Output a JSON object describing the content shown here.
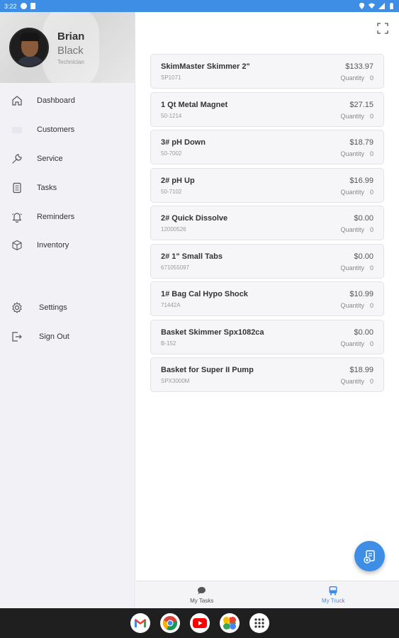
{
  "status_bar": {
    "time": "3:22"
  },
  "profile": {
    "first_name": "Brian",
    "last_name": "Black",
    "role": "Technician"
  },
  "nav": {
    "items": [
      {
        "label": "Dashboard",
        "icon": "home-icon"
      },
      {
        "label": "Customers",
        "icon": "customers-icon"
      },
      {
        "label": "Service",
        "icon": "wrench-icon"
      },
      {
        "label": "Tasks",
        "icon": "tasks-icon"
      },
      {
        "label": "Reminders",
        "icon": "bell-icon"
      },
      {
        "label": "Inventory",
        "icon": "box-icon"
      }
    ],
    "bottom_items": [
      {
        "label": "Settings",
        "icon": "gear-icon"
      },
      {
        "label": "Sign Out",
        "icon": "sign-out-icon"
      }
    ]
  },
  "inventory": {
    "quantity_label": "Quantity",
    "items": [
      {
        "name": "SkimMaster Skimmer 2\"",
        "sku": "SP1071",
        "price": "$133.97",
        "quantity": "0"
      },
      {
        "name": "1 Qt Metal Magnet",
        "sku": "50-1214",
        "price": "$27.15",
        "quantity": "0"
      },
      {
        "name": "3# pH Down",
        "sku": "50-7002",
        "price": "$18.79",
        "quantity": "0"
      },
      {
        "name": "2# pH Up",
        "sku": "50-7102",
        "price": "$16.99",
        "quantity": "0"
      },
      {
        "name": "2# Quick Dissolve",
        "sku": "12000526",
        "price": "$0.00",
        "quantity": "0"
      },
      {
        "name": "2# 1\" Small Tabs",
        "sku": "671055097",
        "price": "$0.00",
        "quantity": "0"
      },
      {
        "name": "1# Bag Cal Hypo Shock",
        "sku": "71442A",
        "price": "$10.99",
        "quantity": "0"
      },
      {
        "name": "Basket Skimmer Spx1082ca",
        "sku": "B-152",
        "price": "$0.00",
        "quantity": "0"
      },
      {
        "name": "Basket for Super II Pump",
        "sku": "SPX3000M",
        "price": "$18.99",
        "quantity": "0"
      }
    ]
  },
  "tabs": {
    "my_tasks": "My Tasks",
    "my_truck": "My Truck"
  },
  "colors": {
    "accent": "#3f8ee6",
    "sidebar_bg": "#f2f2f6",
    "card_bg": "#f6f6f8"
  },
  "dock_apps": [
    "gmail-icon",
    "chrome-icon",
    "youtube-icon",
    "photos-icon",
    "apps-icon"
  ]
}
